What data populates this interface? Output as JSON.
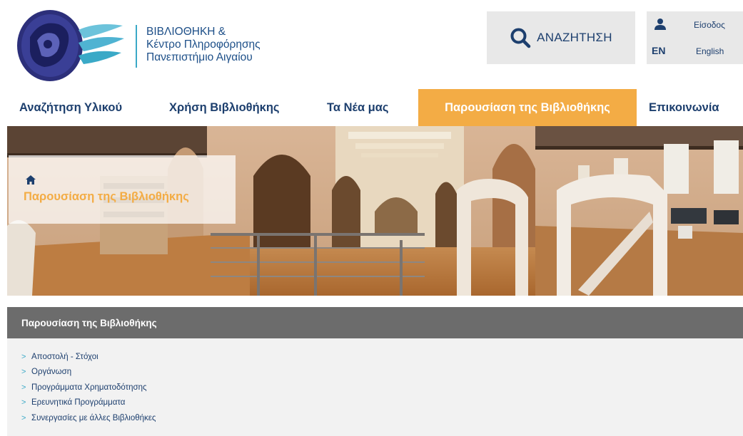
{
  "colors": {
    "accent": "#f3ac45",
    "primary": "#1d3f6e",
    "logo_blue": "#3aa9c7",
    "submenu_header": "#6c6c6c",
    "submenu_body": "#f2f2f2"
  },
  "header": {
    "logo_lines": [
      "ΒΙΒΛΙΟΘΗΚΗ &",
      "Κέντρο Πληροφόρησης",
      "Πανεπιστήμιο Αιγαίου"
    ],
    "search_label": "ΑΝΑΖΗΤΗΣΗ",
    "search_icon": "search-icon",
    "login_icon": "user-icon",
    "login_label": "Είσοδος",
    "language_code": "EN",
    "language_label": "English"
  },
  "nav": {
    "items": [
      {
        "label": "Αναζήτηση Υλικού",
        "active": false
      },
      {
        "label": "Χρήση Βιβλιοθήκης",
        "active": false
      },
      {
        "label": "Τα Νέα μας",
        "active": false
      },
      {
        "label": "Παρουσίαση της Βιβλιοθήκης",
        "active": true
      },
      {
        "label": "Επικοινωνία",
        "active": false
      }
    ]
  },
  "hero": {
    "home_icon": "home-icon",
    "breadcrumb_title": "Παρουσίαση της Βιβλιοθήκης"
  },
  "submenu": {
    "title": "Παρουσίαση της Βιβλιοθήκης",
    "items": [
      {
        "label": "Αποστολή - Στόχοι"
      },
      {
        "label": "Οργάνωση"
      },
      {
        "label": "Προγράμματα Χρηματοδότησης"
      },
      {
        "label": "Ερευνητικά Προγράμματα"
      },
      {
        "label": "Συνεργασίες με άλλες Βιβλιοθήκες"
      }
    ]
  }
}
